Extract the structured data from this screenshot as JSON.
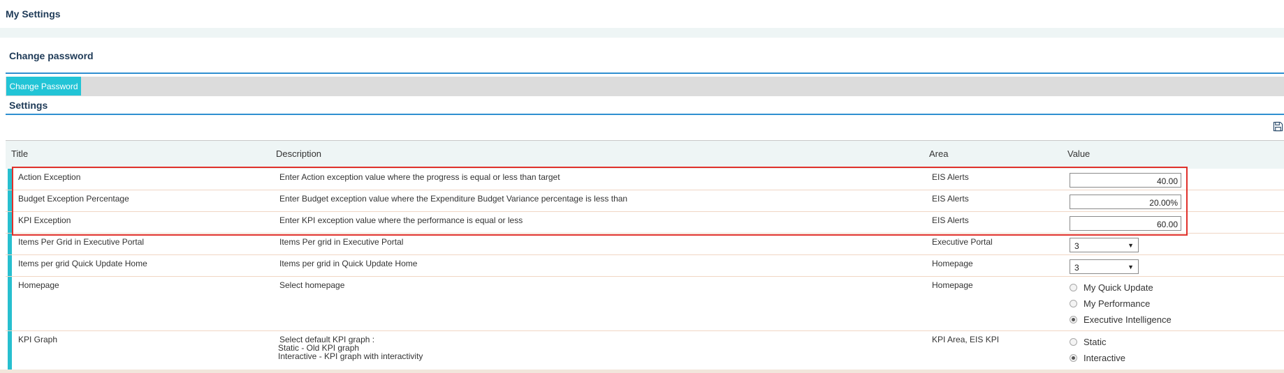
{
  "page": {
    "title": "My Settings"
  },
  "change_password": {
    "heading": "Change password",
    "button_label": "Change Password"
  },
  "settings": {
    "heading": "Settings",
    "save_icon": "save-icon",
    "columns": {
      "title": "Title",
      "description": "Description",
      "area": "Area",
      "value": "Value"
    },
    "rows": [
      {
        "title": "Action Exception",
        "description": "Enter Action exception value where the progress is equal or less than target",
        "area": "EIS Alerts",
        "value": "40.00"
      },
      {
        "title": "Budget Exception Percentage",
        "description": "Enter Budget exception value where the Expenditure Budget Variance percentage is less than",
        "area": "EIS Alerts",
        "value": "20.00%"
      },
      {
        "title": "KPI Exception",
        "description": "Enter KPI exception value where the performance is equal or less",
        "area": "EIS Alerts",
        "value": "60.00"
      },
      {
        "title": "Items Per Grid in Executive Portal",
        "description": "Items Per grid in Executive Portal",
        "area": "Executive Portal",
        "value": "3"
      },
      {
        "title": "Items per grid Quick Update Home",
        "description": "Items per grid in Quick Update Home",
        "area": "Homepage",
        "value": "3"
      },
      {
        "title": "Homepage",
        "description": "Select homepage",
        "area": "Homepage",
        "options": [
          "My Quick Update",
          "My Performance",
          "Executive Intelligence"
        ],
        "selected": "Executive Intelligence"
      },
      {
        "title": "KPI Graph",
        "description_lines": [
          "Select default KPI graph :",
          "Static - Old KPI graph",
          "Interactive - KPI graph with interactivity"
        ],
        "area": "KPI Area, EIS KPI",
        "options": [
          "Static",
          "Interactive"
        ],
        "selected": "Interactive"
      }
    ]
  },
  "colors": {
    "accent": "#27bfcf",
    "heading": "#1e3a57",
    "section_line": "#2f8fd0",
    "highlight": "#e0312b"
  }
}
